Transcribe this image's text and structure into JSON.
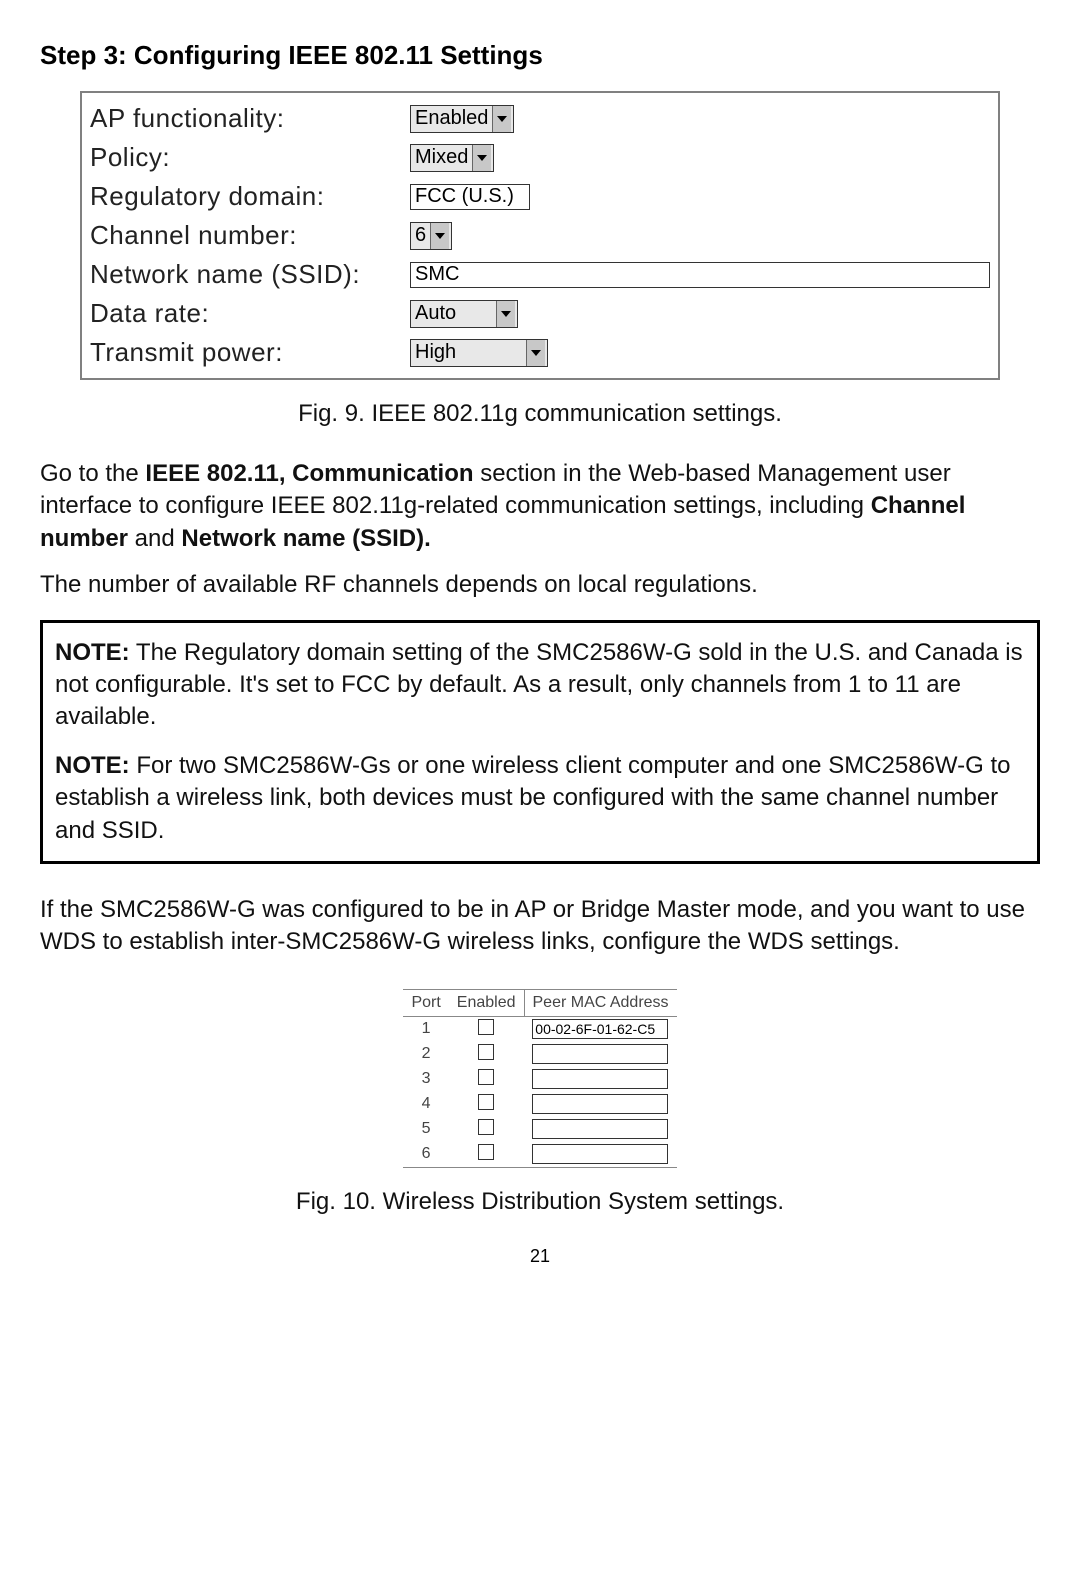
{
  "step_title": "Step 3: Configuring IEEE 802.11 Settings",
  "form": {
    "rows": {
      "ap_functionality": {
        "label": "AP functionality:",
        "value": "Enabled"
      },
      "policy": {
        "label": "Policy:",
        "value": "Mixed"
      },
      "regulatory_domain": {
        "label": "Regulatory domain:",
        "value": "FCC (U.S.)"
      },
      "channel_number": {
        "label": "Channel number:",
        "value": "6"
      },
      "ssid": {
        "label": "Network name (SSID):",
        "value": "SMC"
      },
      "data_rate": {
        "label": "Data rate:",
        "value": "Auto"
      },
      "transmit_power": {
        "label": "Transmit power:",
        "value": "High"
      }
    }
  },
  "fig9_caption": "Fig. 9. IEEE 802.11g communication settings.",
  "para1_pre": "Go to the ",
  "para1_bold1": "IEEE 802.11, Communication",
  "para1_mid": " section in the Web-based Management user interface to configure IEEE 802.11g-related communication settings, including ",
  "para1_bold2": "Channel number",
  "para1_mid2": " and ",
  "para1_bold3": "Network name (SSID).",
  "para2": "The number of available RF channels depends on local regulations.",
  "note1_label": "NOTE:",
  "note1_text": " The Regulatory domain setting of the SMC2586W-G sold in the U.S. and Canada is not configurable. It's set to FCC by default. As a result, only channels from 1 to 11 are available.",
  "note2_label": "NOTE:",
  "note2_text": " For two SMC2586W-Gs or one wireless client computer and one SMC2586W-G to establish a wireless link, both devices must be configured with the same channel number and SSID.",
  "para3": "If the SMC2586W-G was configured to be in AP or Bridge Master mode, and you want to use WDS to establish inter-SMC2586W-G wireless links, configure the WDS settings.",
  "wds": {
    "header_port": "Port",
    "header_enabled": "Enabled",
    "header_peer": "Peer MAC Address",
    "rows": [
      {
        "port": "1",
        "mac": "00-02-6F-01-62-C5"
      },
      {
        "port": "2",
        "mac": ""
      },
      {
        "port": "3",
        "mac": ""
      },
      {
        "port": "4",
        "mac": ""
      },
      {
        "port": "5",
        "mac": ""
      },
      {
        "port": "6",
        "mac": ""
      }
    ]
  },
  "fig10_caption": "Fig. 10. Wireless Distribution System settings.",
  "page_number": "21"
}
